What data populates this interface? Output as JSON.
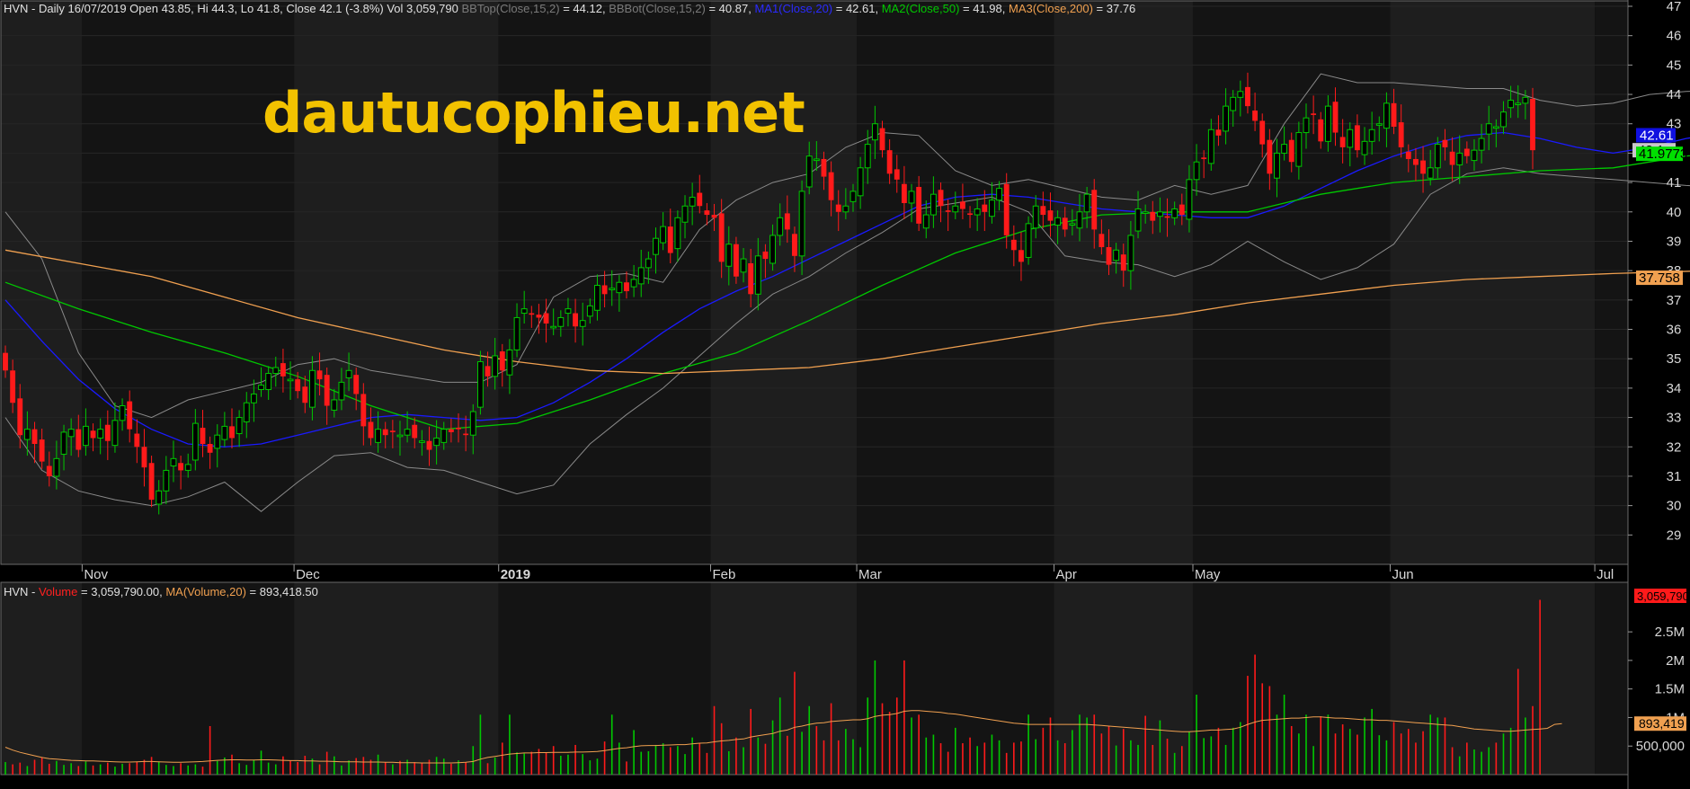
{
  "price_header": {
    "prefix": "HVN - Daily 16/07/2019 Open 43.85, Hi 44.3, Lo 41.8, Close 42.1 (-3.8%) Vol 3,059,790 ",
    "bbtop_label": "BBTop(Close,15,2)",
    "bbtop_value": " = 44.12, ",
    "bbbot_label": "BBBot(Close,15,2)",
    "bbbot_value": " = 40.87, ",
    "ma1_label": "MA1(Close,20)",
    "ma1_value": " = 42.61, ",
    "ma2_label": "MA2(Close,50)",
    "ma2_value": " = 41.98, ",
    "ma3_label": "MA3(Close,200)",
    "ma3_value": " = 37.76"
  },
  "volume_header": {
    "prefix": "HVN - ",
    "volume_label": "Volume",
    "volume_value": " = 3,059,790.00, ",
    "ma_label": "MA(Volume,20)",
    "ma_value": " = 893,418.50"
  },
  "watermark": "dautucophieu.net",
  "badges": {
    "ma1": "42.61",
    "close": "42.1",
    "ma2": "41.9773",
    "ma3": "37.758",
    "volume": "3,059,790",
    "volume_ma": "893,419"
  },
  "colors": {
    "up": "#00c800",
    "down": "#ff1a1a",
    "ma1": "#1a1aff",
    "ma2": "#00c800",
    "ma3": "#f0a050",
    "bb": "#8a8a8a",
    "vol_ma": "#f0a050"
  },
  "chart_data": [
    {
      "type": "candlestick",
      "symbol": "HVN",
      "ylim": [
        28,
        47
      ],
      "yticks": [
        29,
        30,
        31,
        32,
        33,
        34,
        35,
        36,
        37,
        38,
        39,
        40,
        41,
        42,
        43,
        44,
        45,
        46,
        47
      ],
      "x_labels": [
        "Nov",
        "Dec",
        "2019",
        "Feb",
        "Mar",
        "Apr",
        "May",
        "Jun",
        "Jul"
      ],
      "x_label_index": [
        11,
        40,
        68,
        97,
        117,
        144,
        163,
        190,
        218
      ],
      "closes": [
        34.6,
        33.5,
        32.4,
        32.6,
        32.1,
        31.5,
        31,
        31.6,
        32.5,
        32.6,
        31.9,
        32.7,
        32.3,
        32.6,
        32.2,
        32.9,
        33.4,
        32.6,
        32,
        31.3,
        30.2,
        30.5,
        31.2,
        31.6,
        31.2,
        31.4,
        32.8,
        32.1,
        31.8,
        32.4,
        32.7,
        32.3,
        33,
        33.5,
        33.8,
        34.1,
        34.5,
        34.7,
        34.4,
        34.3,
        33.9,
        33.5,
        34.6,
        34.3,
        33.4,
        33.6,
        34.2,
        34.6,
        33.8,
        32.7,
        32.3,
        32.6,
        32.4,
        32.5,
        32.4,
        32.6,
        32.3,
        32.2,
        31.9,
        32.3,
        32.6,
        32.5,
        32.6,
        32.4,
        33.2,
        34.9,
        34.4,
        35.1,
        34.6,
        35.3,
        36.4,
        36.7,
        36.5,
        36.4,
        36.2,
        36.1,
        36.4,
        36.7,
        36.1,
        36.3,
        36.8,
        37.5,
        37.2,
        37.4,
        37.6,
        37.3,
        37.7,
        38.1,
        38.4,
        39.1,
        39.5,
        38.6,
        39.8,
        40.2,
        40.5,
        40.2,
        39.9,
        39.8,
        38.3,
        38.9,
        37.8,
        38.4,
        37.2,
        38.5,
        38.4,
        39.2,
        39.8,
        39.4,
        38.5,
        40.7,
        41.9,
        41.8,
        41.2,
        40.4,
        40,
        40.2,
        40.7,
        41.5,
        42.3,
        43,
        42.1,
        41.3,
        41.1,
        40.3,
        40.7,
        39.6,
        39.9,
        40.6,
        40.2,
        40,
        40.2,
        40.1,
        39.9,
        40.1,
        40,
        40.4,
        40.8,
        39.2,
        38.7,
        38.3,
        39.6,
        40.2,
        39.9,
        39.7,
        39.8,
        39.4,
        39.6,
        40,
        40.6,
        39.4,
        38.8,
        38.2,
        38.7,
        38,
        39.2,
        40.1,
        40,
        39.7,
        40,
        39.8,
        40.1,
        39.9,
        41.1,
        41.7,
        41.8,
        42.8,
        42.6,
        43.6,
        43.9,
        44.1,
        43.6,
        43.1,
        42.3,
        41.3,
        42,
        42.3,
        41.7,
        42.7,
        43.2,
        43.3,
        42.4,
        43.6,
        42.7,
        42.2,
        42.8,
        42.1,
        42.4,
        42.8,
        43,
        43.7,
        42.9,
        42.2,
        41.8,
        41.6,
        41.3,
        41.5,
        42.3,
        42.2,
        41.6,
        42,
        41.9,
        42.1,
        42.5,
        43,
        42.9,
        43.4,
        43.8,
        43.7,
        43.9,
        42.1
      ]
    },
    {
      "type": "line",
      "series": [
        {
          "name": "MA1(Close,20)",
          "color": "#1a1aff",
          "x": [
            0,
            5,
            10,
            15,
            20,
            25,
            30,
            35,
            40,
            45,
            50,
            55,
            60,
            65,
            70,
            75,
            80,
            85,
            90,
            95,
            100,
            105,
            110,
            115,
            120,
            125,
            130,
            135,
            140,
            145,
            150,
            155,
            160,
            165,
            170,
            175,
            180,
            185,
            190,
            195,
            200,
            205,
            210,
            215,
            220,
            225,
            230,
            233
          ],
          "values": [
            37.0,
            35.6,
            34.3,
            33.3,
            32.6,
            32.1,
            32.0,
            32.1,
            32.4,
            32.7,
            33.0,
            33.1,
            33.0,
            32.9,
            33.0,
            33.5,
            34.2,
            35.0,
            35.9,
            36.7,
            37.3,
            37.8,
            38.4,
            39.0,
            39.6,
            40.2,
            40.5,
            40.6,
            40.5,
            40.3,
            40.1,
            40.0,
            39.9,
            39.8,
            39.8,
            40.2,
            40.8,
            41.4,
            41.9,
            42.3,
            42.6,
            42.7,
            42.5,
            42.2,
            42.0,
            42.2,
            42.5,
            42.61
          ]
        },
        {
          "name": "MA2(Close,50)",
          "color": "#00c800",
          "x": [
            0,
            10,
            20,
            30,
            40,
            50,
            60,
            70,
            80,
            90,
            100,
            110,
            120,
            130,
            140,
            150,
            160,
            170,
            180,
            190,
            200,
            210,
            220,
            230,
            233
          ],
          "values": [
            37.6,
            36.7,
            35.9,
            35.2,
            34.4,
            33.4,
            32.6,
            32.8,
            33.6,
            34.5,
            35.2,
            36.3,
            37.5,
            38.6,
            39.4,
            39.9,
            40.0,
            40.0,
            40.6,
            41.0,
            41.2,
            41.4,
            41.5,
            41.9,
            41.98
          ]
        },
        {
          "name": "MA3(Close,200)",
          "color": "#f0a050",
          "x": [
            0,
            20,
            40,
            60,
            70,
            80,
            90,
            100,
            110,
            120,
            130,
            140,
            150,
            160,
            170,
            180,
            190,
            200,
            210,
            220,
            233
          ],
          "values": [
            38.7,
            37.8,
            36.4,
            35.3,
            34.9,
            34.6,
            34.5,
            34.6,
            34.7,
            35.0,
            35.4,
            35.8,
            36.2,
            36.5,
            36.9,
            37.2,
            37.5,
            37.7,
            37.8,
            37.9,
            38.0
          ]
        },
        {
          "name": "BBTop(Close,15,2)",
          "color": "#8a8a8a",
          "x": [
            0,
            5,
            10,
            15,
            20,
            25,
            30,
            35,
            40,
            45,
            50,
            55,
            60,
            65,
            70,
            75,
            80,
            85,
            90,
            95,
            100,
            105,
            110,
            115,
            120,
            125,
            130,
            135,
            140,
            145,
            150,
            155,
            160,
            165,
            170,
            175,
            180,
            185,
            190,
            195,
            200,
            205,
            210,
            215,
            220,
            225,
            230,
            233
          ],
          "values": [
            40,
            38.4,
            35.2,
            33.4,
            33.0,
            33.6,
            33.9,
            34.2,
            34.8,
            35.0,
            34.6,
            34.4,
            34.2,
            34.2,
            34.8,
            37.1,
            37.8,
            37.9,
            37.6,
            39.4,
            40.4,
            41.0,
            41.3,
            42.2,
            42.7,
            42.6,
            41.4,
            40.9,
            41.1,
            40.8,
            40.5,
            40.4,
            40.9,
            40.6,
            40.9,
            43.0,
            44.7,
            44.4,
            44.4,
            44.3,
            44.2,
            44.2,
            43.8,
            43.6,
            43.7,
            44.0,
            44.1,
            44.12
          ]
        },
        {
          "name": "BBBot(Close,15,2)",
          "color": "#8a8a8a",
          "x": [
            0,
            5,
            10,
            15,
            20,
            25,
            30,
            35,
            40,
            45,
            50,
            55,
            60,
            65,
            70,
            75,
            80,
            85,
            90,
            95,
            100,
            105,
            110,
            115,
            120,
            125,
            130,
            135,
            140,
            145,
            150,
            155,
            160,
            165,
            170,
            175,
            180,
            185,
            190,
            195,
            200,
            205,
            210,
            215,
            220,
            225,
            230,
            233
          ],
          "values": [
            33.0,
            31.2,
            30.5,
            30.2,
            30.0,
            30.3,
            30.8,
            29.8,
            30.8,
            31.7,
            31.8,
            31.3,
            31.2,
            30.8,
            30.4,
            30.7,
            32.1,
            33.1,
            34.0,
            35.1,
            36.2,
            37.2,
            37.8,
            38.6,
            39.3,
            40.1,
            40.3,
            40.5,
            40.0,
            38.5,
            38.3,
            38.2,
            37.8,
            38.2,
            39.0,
            38.3,
            37.7,
            38.1,
            38.9,
            40.6,
            41.3,
            41.5,
            41.3,
            41.2,
            41.1,
            41.0,
            40.9,
            40.87
          ]
        }
      ]
    },
    {
      "type": "bar",
      "title": "Volume",
      "ylim": [
        0,
        3100000
      ],
      "yticks": [
        500000,
        1000000,
        1500000,
        2000000,
        2500000
      ],
      "ytick_labels": [
        "500,000",
        "1M",
        "1.5M",
        "2M",
        "2.5M"
      ],
      "values": [
        220000,
        180000,
        210000,
        150000,
        260000,
        300000,
        190000,
        240000,
        170000,
        200000,
        150000,
        230000,
        160000,
        180000,
        210000,
        140000,
        190000,
        200000,
        220000,
        260000,
        310000,
        230000,
        170000,
        150000,
        200000,
        160000,
        180000,
        140000,
        850000,
        240000,
        300000,
        350000,
        200000,
        170000,
        260000,
        420000,
        210000,
        180000,
        320000,
        240000,
        220000,
        330000,
        280000,
        180000,
        400000,
        320000,
        160000,
        250000,
        290000,
        310000,
        260000,
        350000,
        220000,
        180000,
        240000,
        260000,
        220000,
        200000,
        260000,
        310000,
        280000,
        190000,
        250000,
        220000,
        500000,
        1050000,
        200000,
        300000,
        560000,
        1050000,
        390000,
        370000,
        400000,
        450000,
        380000,
        500000,
        330000,
        350000,
        520000,
        360000,
        250000,
        280000,
        580000,
        1050000,
        560000,
        230000,
        780000,
        400000,
        410000,
        520000,
        550000,
        480000,
        500000,
        360000,
        650000,
        550000,
        380000,
        1200000,
        900000,
        410000,
        650000,
        480000,
        1150000,
        650000,
        540000,
        950000,
        1350000,
        680000,
        1800000,
        750000,
        1200000,
        850000,
        600000,
        1250000,
        600000,
        800000,
        620000,
        480000,
        1350000,
        2000000,
        1250000,
        1100000,
        1350000,
        2000000,
        1000000,
        1050000,
        650000,
        700000,
        550000,
        400000,
        820000,
        550000,
        650000,
        500000,
        560000,
        700000,
        600000,
        380000,
        560000,
        580000,
        1050000,
        620000,
        820000,
        1000000,
        600000,
        550000,
        780000,
        1050000,
        1000000,
        1050000,
        720000,
        850000,
        510000,
        800000,
        600000,
        520000,
        1030000,
        520000,
        950000,
        630000,
        380000,
        500000,
        750000,
        1400000,
        640000,
        670000,
        820000,
        520000,
        820000,
        920000,
        1730000,
        2100000,
        1600000,
        1550000,
        1050000,
        1400000,
        850000,
        720000,
        1050000,
        500000,
        1020000,
        1050000,
        720000,
        880000,
        800000,
        700000,
        1000000,
        1150000,
        690000,
        600000,
        920000,
        720000,
        800000,
        560000,
        760000,
        1050000,
        1000000,
        1000000,
        480000,
        320000,
        560000,
        440000,
        400000,
        480000,
        560000,
        720000,
        820000,
        1850000,
        1000000,
        1200000,
        3059790
      ],
      "ma_values": [
        480000,
        430000,
        390000,
        360000,
        330000,
        300000,
        280000,
        270000,
        260000,
        250000,
        245000,
        240000,
        240000,
        235000,
        230000,
        225000,
        220000,
        220000,
        225000,
        230000,
        230000,
        225000,
        220000,
        215000,
        215000,
        220000,
        225000,
        230000,
        240000,
        250000,
        255000,
        260000,
        260000,
        255000,
        255000,
        260000,
        260000,
        255000,
        250000,
        245000,
        245000,
        240000,
        240000,
        235000,
        235000,
        230000,
        225000,
        225000,
        225000,
        220000,
        220000,
        220000,
        215000,
        215000,
        210000,
        210000,
        210000,
        205000,
        205000,
        205000,
        205000,
        205000,
        210000,
        215000,
        230000,
        270000,
        300000,
        320000,
        340000,
        360000,
        370000,
        380000,
        380000,
        385000,
        385000,
        390000,
        390000,
        390000,
        395000,
        395000,
        400000,
        405000,
        420000,
        440000,
        460000,
        470000,
        490000,
        505000,
        510000,
        510000,
        515000,
        520000,
        525000,
        525000,
        540000,
        550000,
        555000,
        575000,
        590000,
        600000,
        615000,
        625000,
        660000,
        680000,
        700000,
        720000,
        760000,
        780000,
        830000,
        850000,
        880000,
        900000,
        910000,
        930000,
        940000,
        950000,
        960000,
        960000,
        980000,
        1020000,
        1040000,
        1050000,
        1070000,
        1110000,
        1120000,
        1120000,
        1110000,
        1100000,
        1090000,
        1070000,
        1060000,
        1040000,
        1020000,
        1000000,
        980000,
        960000,
        940000,
        920000,
        900000,
        890000,
        880000,
        880000,
        880000,
        880000,
        880000,
        880000,
        880000,
        880000,
        880000,
        870000,
        860000,
        850000,
        840000,
        830000,
        820000,
        810000,
        800000,
        790000,
        780000,
        770000,
        760000,
        750000,
        750000,
        760000,
        770000,
        780000,
        780000,
        790000,
        800000,
        830000,
        880000,
        920000,
        950000,
        960000,
        970000,
        980000,
        990000,
        990000,
        1000000,
        1010000,
        1010000,
        1000000,
        990000,
        990000,
        980000,
        970000,
        960000,
        960000,
        950000,
        950000,
        940000,
        930000,
        920000,
        910000,
        900000,
        890000,
        880000,
        870000,
        860000,
        840000,
        820000,
        800000,
        790000,
        780000,
        770000,
        760000,
        760000,
        770000,
        780000,
        790000,
        800000,
        810000,
        880000,
        893419
      ]
    }
  ]
}
